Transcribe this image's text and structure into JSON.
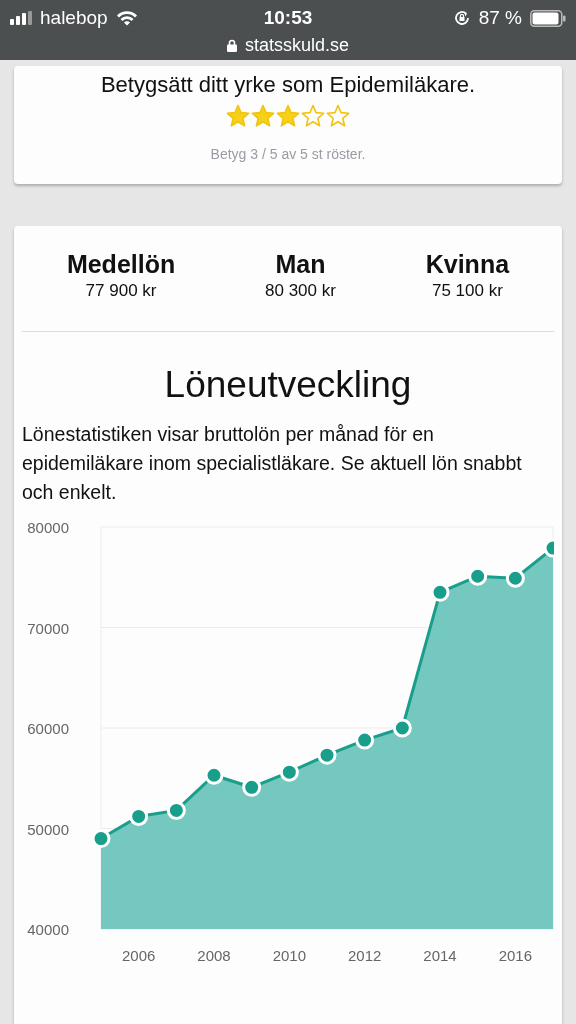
{
  "status_bar": {
    "carrier": "halebop",
    "time": "10:53",
    "battery": "87 %"
  },
  "address_bar": {
    "url": "statsskuld.se"
  },
  "rating": {
    "title": "Betygsätt ditt yrke som Epidemiläkare.",
    "stars": 3,
    "summary": "Betyg 3 / 5 av 5 st röster."
  },
  "salaries": [
    {
      "label": "Medellön",
      "value": "77 900 kr"
    },
    {
      "label": "Man",
      "value": "80 300 kr"
    },
    {
      "label": "Kvinna",
      "value": "75 100 kr"
    }
  ],
  "heading": "Löneutveckling",
  "description": "Lönestatistiken visar bruttolön per månad för en epidemiläkare inom specialistläkare. Se aktuell lön snabbt och enkelt.",
  "chart_data": {
    "type": "area",
    "x": [
      2005,
      2006,
      2007,
      2008,
      2009,
      2010,
      2011,
      2012,
      2013,
      2014,
      2015,
      2016,
      2017
    ],
    "grid": true,
    "series": [
      {
        "color": "#1a9e8c",
        "values": [
          49000,
          51200,
          51800,
          55300,
          54100,
          55600,
          57300,
          58800,
          60000,
          73500,
          75100,
          74900,
          77900
        ]
      }
    ],
    "xlim": [
      2005,
      2017
    ],
    "ylim": [
      40000,
      80000
    ],
    "xticks": [
      2006,
      2008,
      2010,
      2012,
      2014,
      2016
    ],
    "yticks": [
      40000,
      50000,
      60000,
      70000,
      80000
    ]
  }
}
